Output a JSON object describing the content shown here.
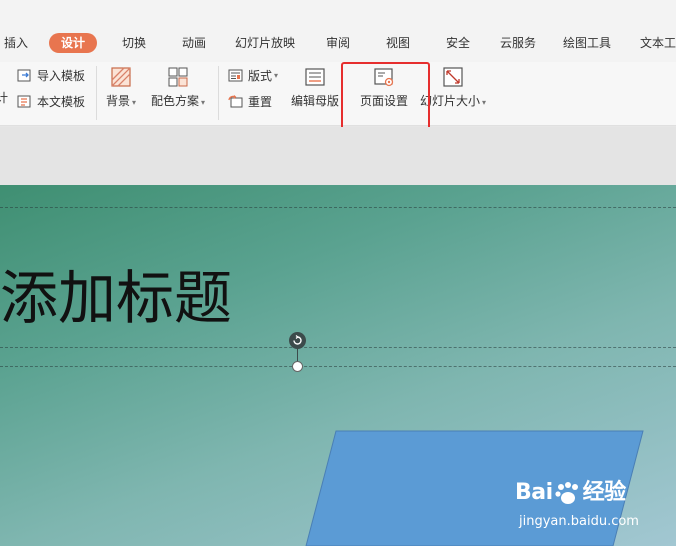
{
  "tabs": [
    {
      "label": "插入",
      "active": false
    },
    {
      "label": "设计",
      "active": true
    },
    {
      "label": "切换",
      "active": false
    },
    {
      "label": "动画",
      "active": false
    },
    {
      "label": "幻灯片放映",
      "active": false
    },
    {
      "label": "审阅",
      "active": false
    },
    {
      "label": "视图",
      "active": false
    },
    {
      "label": "安全",
      "active": false
    },
    {
      "label": "云服务",
      "active": false
    },
    {
      "label": "绘图工具",
      "active": false
    },
    {
      "label": "文本工",
      "active": false
    }
  ],
  "ribbon": {
    "import_template": "导入模板",
    "text_template": "本文模板",
    "partial_label": "计",
    "background": "背景",
    "color_scheme": "配色方案",
    "layout": "版式",
    "reset": "重置",
    "edit_master": "编辑母版",
    "page_setup": "页面设置",
    "slide_size": "幻灯片大小"
  },
  "slide": {
    "title": "添加标题"
  },
  "watermark": {
    "brand": "Bai",
    "brand2": "经验",
    "url": "jingyan.baidu.com"
  },
  "colors": {
    "active_tab": "#e8754f",
    "highlight": "#e62e2e",
    "shape_fill": "#5b9bd5"
  }
}
